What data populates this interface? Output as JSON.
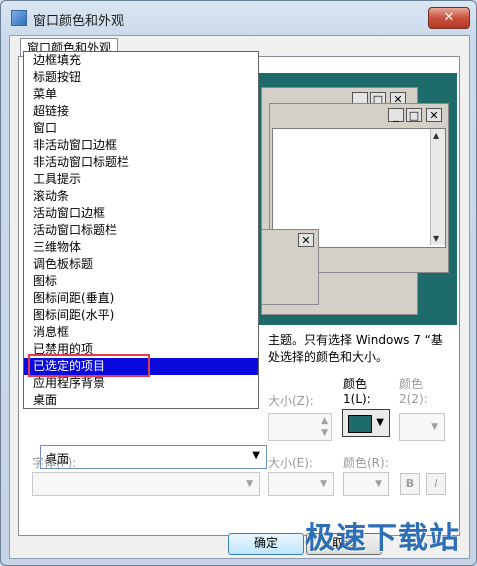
{
  "window": {
    "title": "窗口颜色和外观",
    "close_glyph": "✕",
    "tab_label": "窗口颜色和外观"
  },
  "preview": {
    "close_glyph": "✕",
    "max_glyph": "□",
    "min_glyph": "_",
    "scroll_up": "▲",
    "scroll_down": "▼"
  },
  "description": {
    "line1": "主题。只有选择 Windows 7 “基",
    "line2": "处选择的颜色和大小。"
  },
  "item_list": {
    "items": [
      "边框填充",
      "标题按钮",
      "菜单",
      "超链接",
      "窗口",
      "非活动窗口边框",
      "非活动窗口标题栏",
      "工具提示",
      "滚动条",
      "活动窗口边框",
      "活动窗口标题栏",
      "三维物体",
      "调色板标题",
      "图标",
      "图标间距(垂直)",
      "图标间距(水平)",
      "消息框",
      "已禁用的项",
      "已选定的项目",
      "应用程序背景",
      "桌面"
    ],
    "selected_index": 18
  },
  "item_combo": {
    "value": "桌面",
    "arrow": "▼"
  },
  "size_label": "大小(Z):",
  "color1_label_top": "颜色",
  "color1_label_bottom": "1(L):",
  "color2_label_top": "颜色",
  "color2_label_bottom": "2(2):",
  "font_label": "字体(F):",
  "font_size_label": "大小(E):",
  "font_color_label": "颜色(R):",
  "bold_label": "B",
  "italic_label": "I",
  "color1_value": "#1f6b6b",
  "buttons": {
    "ok": "确定",
    "cancel": "取消"
  },
  "watermark": "极速下载站",
  "icons": {
    "app": "color-palette-icon",
    "close": "close-icon"
  }
}
